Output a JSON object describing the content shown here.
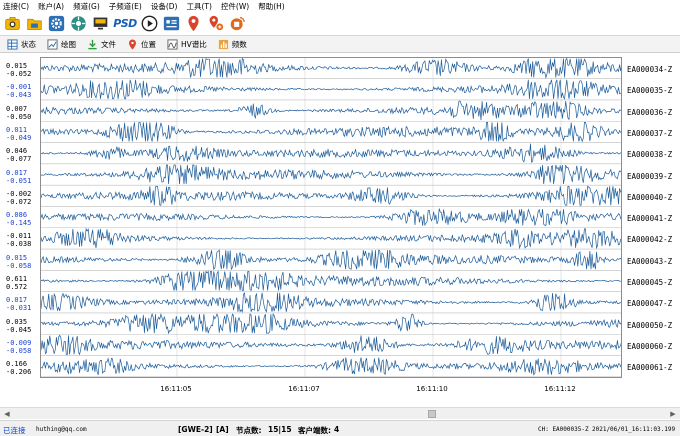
{
  "menu": [
    "连接(C)",
    "账户(A)",
    "频道(G)",
    "子频道(E)",
    "设备(D)",
    "工具(T)",
    "控件(W)",
    "帮助(H)"
  ],
  "toolbar_icons": [
    {
      "name": "camera-icon",
      "color": "#e2a400"
    },
    {
      "name": "folder-icon",
      "color": "#e2a400"
    },
    {
      "name": "gear-icon",
      "color": "#2c6fb5"
    },
    {
      "name": "sensor-icon",
      "color": "#2f8f83"
    },
    {
      "name": "monitor-icon",
      "color": "#333333"
    },
    {
      "name": "psd-icon",
      "color": "#1a5fb4"
    },
    {
      "name": "play-icon",
      "color": "#222222"
    },
    {
      "name": "device-card-icon",
      "color": "#2c6fb5"
    },
    {
      "name": "map-pin-icon",
      "color": "#d9452b"
    },
    {
      "name": "share-location-icon",
      "color": "#d9452b"
    },
    {
      "name": "broadcast-icon",
      "color": "#e06a1a"
    }
  ],
  "psd_label": "PSD",
  "tabs": [
    {
      "label": "状态",
      "icon": "status-grid-icon"
    },
    {
      "label": "绘图",
      "icon": "chart-icon"
    },
    {
      "label": "文件",
      "icon": "download-icon"
    },
    {
      "label": "位置",
      "icon": "map-pin-icon"
    },
    {
      "label": "HV谱比",
      "icon": "hv-spectrum-icon"
    },
    {
      "label": "频数",
      "icon": "frequency-icon"
    }
  ],
  "channels": [
    {
      "name": "EA000034-Z",
      "max": "0.015",
      "min": "-0.052",
      "color": "#000000"
    },
    {
      "name": "EA000035-Z",
      "max": "-0.001",
      "min": "-0.043",
      "color": "#1a3fd1"
    },
    {
      "name": "EA000036-Z",
      "max": "0.007",
      "min": "-0.050",
      "color": "#000000"
    },
    {
      "name": "EA000037-Z",
      "max": "0.011",
      "min": "-0.049",
      "color": "#1a3fd1"
    },
    {
      "name": "EA000038-Z",
      "max": "0.046",
      "min": "-0.077",
      "color": "#000000"
    },
    {
      "name": "EA000039-Z",
      "max": "0.017",
      "min": "-0.051",
      "color": "#1a3fd1"
    },
    {
      "name": "EA000040-Z",
      "max": "-0.002",
      "min": "-0.072",
      "color": "#000000"
    },
    {
      "name": "EA000041-Z",
      "max": "0.086",
      "min": "-0.145",
      "color": "#1a3fd1"
    },
    {
      "name": "EA000042-Z",
      "max": "-0.011",
      "min": "-0.038",
      "color": "#000000"
    },
    {
      "name": "EA000043-Z",
      "max": "0.015",
      "min": "-0.058",
      "color": "#1a3fd1"
    },
    {
      "name": "EA000045-Z",
      "max": "0.611",
      "min": "0.572",
      "color": "#000000"
    },
    {
      "name": "EA000047-Z",
      "max": "0.017",
      "min": "-0.031",
      "color": "#1a3fd1"
    },
    {
      "name": "EA000050-Z",
      "max": "0.035",
      "min": "-0.045",
      "color": "#000000"
    },
    {
      "name": "EA000060-Z",
      "max": "-0.009",
      "min": "-0.058",
      "color": "#1a3fd1"
    },
    {
      "name": "EA000061-Z",
      "max": "0.166",
      "min": "-0.206",
      "color": "#000000"
    }
  ],
  "time_ticks": [
    "16:11:05",
    "16:11:07",
    "16:11:10",
    "16:11:12"
  ],
  "trace_color": "#1d5d9b",
  "status": {
    "connection": "已连接",
    "email": "huthing@qq.com",
    "device": "[GWE-2]",
    "mode": "[A]",
    "nodes_label": "节点数:",
    "nodes_value": "15|15",
    "clients_label": "客户端数:",
    "clients_value": "4",
    "channel": "CH: EA000035-Z",
    "datetime": "2021/06/01_16:11:03.199"
  }
}
